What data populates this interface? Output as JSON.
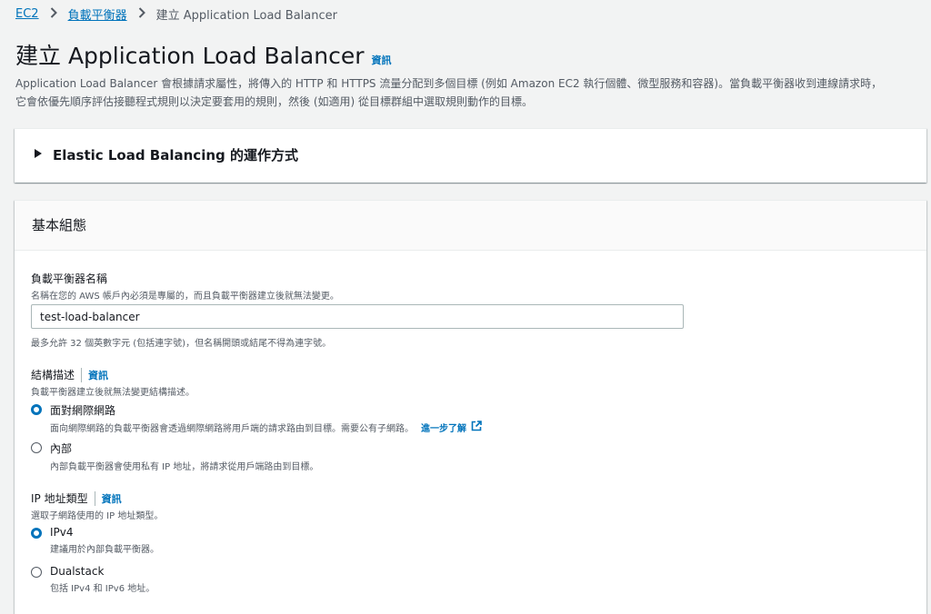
{
  "breadcrumb": {
    "items": [
      "EC2",
      "負載平衡器",
      "建立 Application Load Balancer"
    ]
  },
  "page": {
    "title": "建立 Application Load Balancer",
    "info_label": "資訊",
    "description_line1": "Application Load Balancer 會根據請求屬性，將傳入的 HTTP 和 HTTPS 流量分配到多個目標 (例如 Amazon EC2 執行個體、微型服務和容器)。當負載平衡器收到連線請求時，",
    "description_line2": "它會依優先順序評估接聽程式規則以決定要套用的規則，然後 (如適用) 從目標群組中選取規則動作的目標。"
  },
  "expander": {
    "title": "Elastic Load Balancing 的運作方式"
  },
  "basic_config": {
    "header": "基本組態",
    "name_field": {
      "label": "負載平衡器名稱",
      "description": "名稱在您的 AWS 帳戶內必須是專屬的，而且負載平衡器建立後就無法變更。",
      "value": "test-load-balancer",
      "hint": "最多允許 32 個英數字元 (包括連字號)，但名稱開頭或結尾不得為連字號。"
    },
    "scheme": {
      "label": "結構描述",
      "info_label": "資訊",
      "description": "負載平衡器建立後就無法變更結構描述。",
      "options": [
        {
          "label": "面對網際網路",
          "description": "面向網際網路的負載平衡器會透過網際網路將用戶端的請求路由到目標。需要公有子網路。",
          "link": "進一步了解",
          "checked": true
        },
        {
          "label": "內部",
          "description": "內部負載平衡器會使用私有 IP 地址，將請求從用戶端路由到目標。",
          "checked": false
        }
      ]
    },
    "ip_type": {
      "label": "IP 地址類型",
      "info_label": "資訊",
      "description": "選取子網路使用的 IP 地址類型。",
      "options": [
        {
          "label": "IPv4",
          "description": "建議用於內部負載平衡器。",
          "checked": true
        },
        {
          "label": "Dualstack",
          "description": "包括 IPv4 和 IPv6 地址。",
          "checked": false
        }
      ]
    }
  },
  "icons": {
    "breadcrumb_separator": "chevron-right-icon",
    "expander": "caret-right-icon",
    "external_link": "external-link-icon"
  },
  "colors": {
    "link": "#0073bb",
    "background": "#f2f3f3",
    "text": "#16191f",
    "muted": "#545b64"
  }
}
